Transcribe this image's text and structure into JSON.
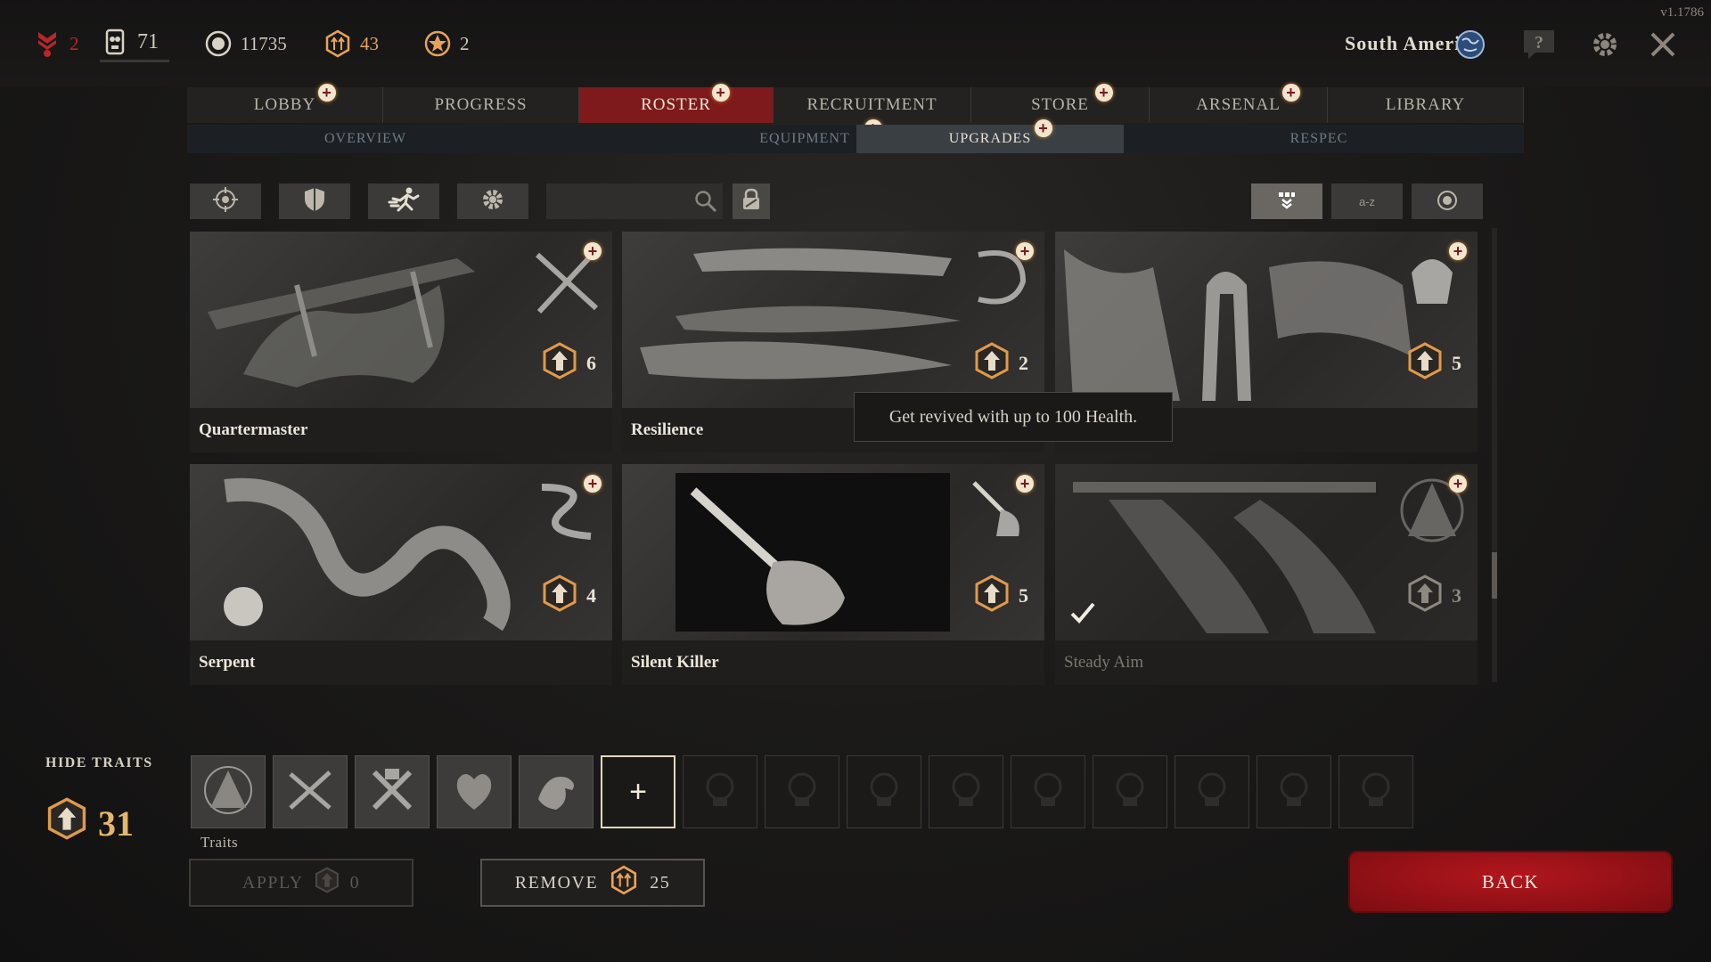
{
  "version": "v1.1786",
  "topbar": {
    "resources": [
      {
        "icon": "rank-chevron-icon",
        "value": "2",
        "color": "#b8262a"
      },
      {
        "icon": "skull-tag-icon",
        "value": "71"
      },
      {
        "icon": "hunt-dollar-icon",
        "value": "11735"
      },
      {
        "icon": "blood-bond-icon",
        "value": "43",
        "color": "#e8a257"
      },
      {
        "icon": "event-point-icon",
        "value": "2",
        "color": "#e8a257"
      }
    ],
    "region": "South America",
    "icons": [
      "globe-icon",
      "help-icon",
      "settings-icon",
      "close-icon"
    ]
  },
  "tabs": [
    {
      "label": "LOBBY",
      "badge": true
    },
    {
      "label": "PROGRESS",
      "badge": false
    },
    {
      "label": "ROSTER",
      "badge": true,
      "active": true
    },
    {
      "label": "RECRUITMENT",
      "badge": false
    },
    {
      "label": "STORE",
      "badge": true
    },
    {
      "label": "ARSENAL",
      "badge": true
    },
    {
      "label": "LIBRARY",
      "badge": false
    }
  ],
  "subtabs": [
    {
      "label": "OVERVIEW",
      "badge": false
    },
    {
      "label": "EQUIPMENT",
      "badge": true
    },
    {
      "label": "UPGRADES",
      "badge": true,
      "active": true
    },
    {
      "label": "RESPEC",
      "badge": false
    }
  ],
  "filters": {
    "categories": [
      "crosshair-icon",
      "shield-icon",
      "running-icon",
      "gear-icon"
    ],
    "search_placeholder": "",
    "sort": [
      {
        "label": "",
        "icon": "rank-sort-icon",
        "active": true
      },
      {
        "label": "a-z",
        "active": false
      },
      {
        "label": "",
        "icon": "cost-sort-icon",
        "active": false
      }
    ]
  },
  "traits": [
    {
      "name": "Quartermaster",
      "cost": "6",
      "badge": true,
      "dim": false
    },
    {
      "name": "Resilience",
      "cost": "2",
      "badge": true,
      "dim": false
    },
    {
      "name": "",
      "cost": "5",
      "badge": true,
      "dim": false
    },
    {
      "name": "Serpent",
      "cost": "4",
      "badge": true,
      "dim": false
    },
    {
      "name": "Silent Killer",
      "cost": "5",
      "badge": true,
      "dim": false
    },
    {
      "name": "Steady Aim",
      "cost": "3",
      "badge": true,
      "dim": true,
      "equipped": true
    }
  ],
  "tooltip": "Get revived with up to 100 Health.",
  "hide_traits_label": "HIDE TRAITS",
  "upgrade_points": "31",
  "slots_label": "Traits",
  "slots": {
    "filled": [
      "steady-aim-trait-icon",
      "quartermaster-trait-icon",
      "tool-trait-icon",
      "heart-trait-icon",
      "vulture-trait-icon"
    ],
    "add_symbol": "+",
    "empty_count": 9
  },
  "buttons": {
    "apply": {
      "label": "APPLY",
      "value": "0"
    },
    "remove": {
      "label": "REMOVE",
      "value": "25"
    },
    "back": {
      "label": "BACK"
    }
  }
}
